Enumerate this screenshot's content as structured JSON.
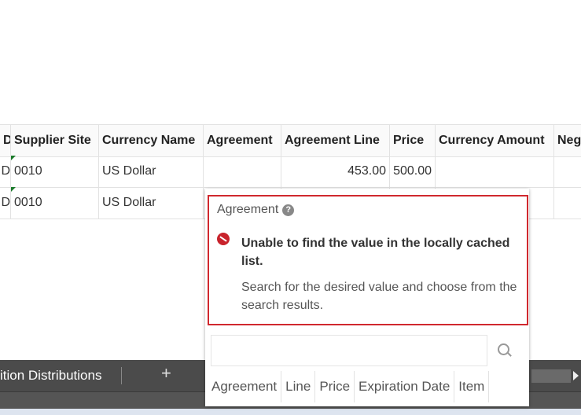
{
  "table": {
    "columns": [
      "D",
      "Supplier Site",
      "Currency Name",
      "Agreement",
      "Agreement Line",
      "Price",
      "Currency Amount",
      "Neg"
    ],
    "rows": [
      [
        "D",
        "0010",
        "US Dollar",
        "",
        "453.00",
        "500.00",
        "",
        ""
      ],
      [
        "D",
        "0010",
        "US Dollar",
        "",
        "",
        "",
        "",
        ""
      ]
    ]
  },
  "bottom_bar": {
    "tab_label": "ition Distributions",
    "add_label": "+"
  },
  "popup": {
    "field_label": "Agreement",
    "help": "?",
    "error_title": "Unable to find the value in the locally cached list.",
    "error_body": "Search for the desired value and choose from the search results.",
    "search_value": "",
    "columns": [
      "Agreement",
      "Line",
      "Price",
      "Expiration Date",
      "Item"
    ]
  },
  "colors": {
    "error": "#d0282e",
    "bar": "#4b4b4b"
  }
}
